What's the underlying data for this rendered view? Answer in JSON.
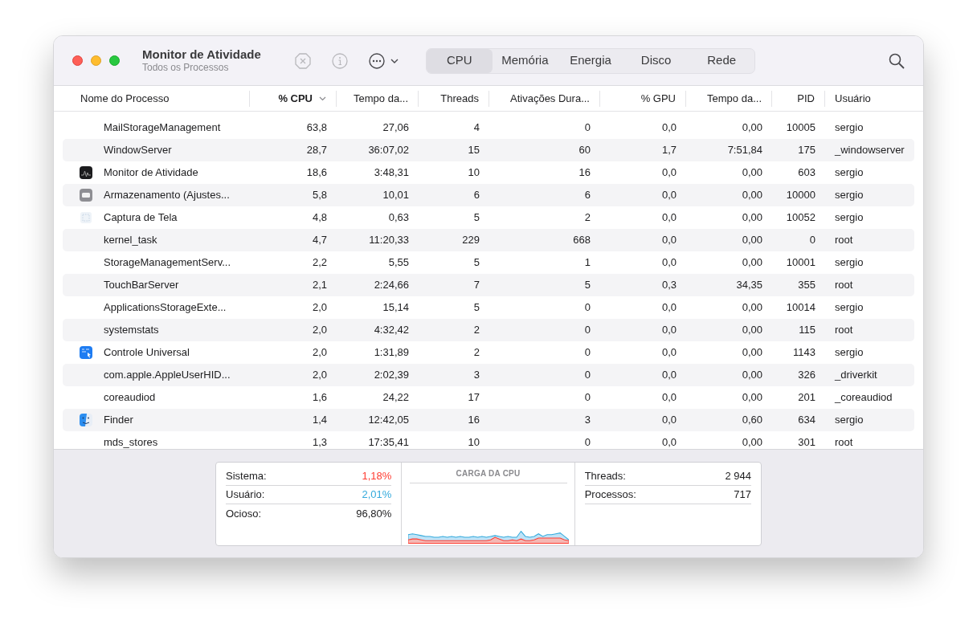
{
  "window": {
    "title": "Monitor de Atividade",
    "subtitle": "Todos os Processos"
  },
  "tabs": [
    {
      "label": "CPU",
      "selected": true
    },
    {
      "label": "Memória",
      "selected": false
    },
    {
      "label": "Energia",
      "selected": false
    },
    {
      "label": "Disco",
      "selected": false
    },
    {
      "label": "Rede",
      "selected": false
    }
  ],
  "table": {
    "columns": [
      {
        "label": "Nome do Processo",
        "sorted": false
      },
      {
        "label": "% CPU",
        "sorted": true
      },
      {
        "label": "Tempo da...",
        "sorted": false
      },
      {
        "label": "Threads",
        "sorted": false
      },
      {
        "label": "Ativações Dura...",
        "sorted": false
      },
      {
        "label": "% GPU",
        "sorted": false
      },
      {
        "label": "Tempo da...",
        "sorted": false
      },
      {
        "label": "PID",
        "sorted": false
      },
      {
        "label": "Usuário",
        "sorted": false
      }
    ],
    "rows": [
      {
        "kind": "process",
        "cells": [
          "MailStorageManagement",
          "63,8",
          "27,06",
          "4",
          "0",
          "0,0",
          "0,00",
          "10005",
          "sergio"
        ]
      },
      {
        "kind": "process",
        "cells": [
          "WindowServer",
          "28,7",
          "36:07,02",
          "15",
          "60",
          "1,7",
          "7:51,84",
          "175",
          "_windowserver"
        ]
      },
      {
        "kind": "monitor",
        "cells": [
          "Monitor de Atividade",
          "18,6",
          "3:48,31",
          "10",
          "16",
          "0,0",
          "0,00",
          "603",
          "sergio"
        ]
      },
      {
        "kind": "storage",
        "cells": [
          "Armazenamento (Ajustes...",
          "5,8",
          "10,01",
          "6",
          "6",
          "0,0",
          "0,00",
          "10000",
          "sergio"
        ]
      },
      {
        "kind": "screenshot",
        "cells": [
          "Captura de Tela",
          "4,8",
          "0,63",
          "5",
          "2",
          "0,0",
          "0,00",
          "10052",
          "sergio"
        ]
      },
      {
        "kind": "process",
        "cells": [
          "kernel_task",
          "4,7",
          "11:20,33",
          "229",
          "668",
          "0,0",
          "0,00",
          "0",
          "root"
        ]
      },
      {
        "kind": "process",
        "cells": [
          "StorageManagementServ...",
          "2,2",
          "5,55",
          "5",
          "1",
          "0,0",
          "0,00",
          "10001",
          "sergio"
        ]
      },
      {
        "kind": "process",
        "cells": [
          "TouchBarServer",
          "2,1",
          "2:24,66",
          "7",
          "5",
          "0,3",
          "34,35",
          "355",
          "root"
        ]
      },
      {
        "kind": "process",
        "cells": [
          "ApplicationsStorageExte...",
          "2,0",
          "15,14",
          "5",
          "0",
          "0,0",
          "0,00",
          "10014",
          "sergio"
        ]
      },
      {
        "kind": "process",
        "cells": [
          "systemstats",
          "2,0",
          "4:32,42",
          "2",
          "0",
          "0,0",
          "0,00",
          "115",
          "root"
        ]
      },
      {
        "kind": "remote",
        "cells": [
          "Controle Universal",
          "2,0",
          "1:31,89",
          "2",
          "0",
          "0,0",
          "0,00",
          "1143",
          "sergio"
        ]
      },
      {
        "kind": "process",
        "cells": [
          "com.apple.AppleUserHID...",
          "2,0",
          "2:02,39",
          "3",
          "0",
          "0,0",
          "0,00",
          "326",
          "_driverkit"
        ]
      },
      {
        "kind": "process",
        "cells": [
          "coreaudiod",
          "1,6",
          "24,22",
          "17",
          "0",
          "0,0",
          "0,00",
          "201",
          "_coreaudiod"
        ]
      },
      {
        "kind": "finder",
        "cells": [
          "Finder",
          "1,4",
          "12:42,05",
          "16",
          "3",
          "0,0",
          "0,60",
          "634",
          "sergio"
        ]
      },
      {
        "kind": "process",
        "cells": [
          "mds_stores",
          "1,3",
          "17:35,41",
          "10",
          "0",
          "0,0",
          "0,00",
          "301",
          "root"
        ]
      }
    ]
  },
  "summary": {
    "load": [
      {
        "label": "Sistema:",
        "value": "1,18%",
        "color": "#ff3b30"
      },
      {
        "label": "Usuário:",
        "value": "2,01%",
        "color": "#34aadc"
      },
      {
        "label": "Ocioso:",
        "value": "96,80%",
        "color": "#1d1d1f"
      }
    ],
    "chart_title": "CARGA DA CPU",
    "counts": [
      {
        "label": "Threads:",
        "value": "2 944"
      },
      {
        "label": "Processos:",
        "value": "717"
      }
    ]
  }
}
